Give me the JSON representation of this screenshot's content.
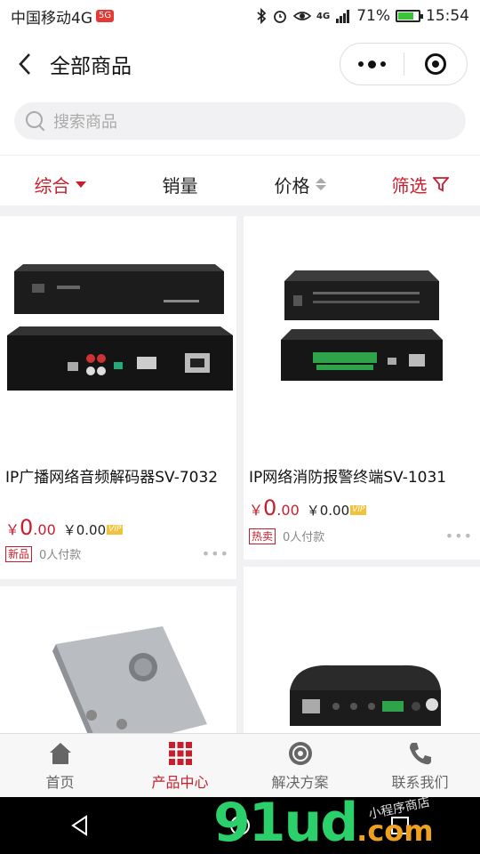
{
  "status_bar": {
    "carrier": "中国移动4G",
    "carrier_badge": "5G",
    "signal_label": "4G",
    "battery_pct": "71%",
    "battery_level": 0.71,
    "time": "15:54"
  },
  "nav": {
    "title": "全部商品"
  },
  "search": {
    "placeholder": "搜索商品"
  },
  "sort_bar": {
    "items": [
      {
        "label": "综合"
      },
      {
        "label": "销量"
      },
      {
        "label": "价格"
      },
      {
        "label": "筛选"
      }
    ]
  },
  "products": [
    {
      "name": "IP广播网络音频解码器SV-7032",
      "currency": "￥",
      "price_int": "0",
      "price_dec": ".00",
      "vip_price": "￥0.00",
      "vip_tag": "VIP",
      "badge": "新品",
      "sold": "0人付款"
    },
    {
      "name": "IP网络消防报警终端SV-1031",
      "currency": "￥",
      "price_int": "0",
      "price_dec": ".00",
      "vip_price": "￥0.00",
      "vip_tag": "VIP",
      "badge": "热卖",
      "sold": "0人付款"
    },
    {
      "name": "",
      "currency": "",
      "price_int": "",
      "price_dec": "",
      "vip_price": "",
      "vip_tag": "",
      "badge": "",
      "sold": ""
    },
    {
      "name": "",
      "currency": "",
      "price_int": "",
      "price_dec": "",
      "vip_price": "",
      "vip_tag": "",
      "badge": "",
      "sold": ""
    }
  ],
  "tab_bar": {
    "tabs": [
      {
        "label": "首页",
        "icon": "home-icon"
      },
      {
        "label": "产品中心",
        "icon": "grid-icon"
      },
      {
        "label": "解决方案",
        "icon": "disc-icon"
      },
      {
        "label": "联系我们",
        "icon": "phone-icon"
      }
    ]
  },
  "watermark": {
    "main": "91ud",
    "suffix": ".com",
    "sub": "小程序商店"
  },
  "colors": {
    "accent": "#c81e2c",
    "vip": "#f2c23a"
  }
}
